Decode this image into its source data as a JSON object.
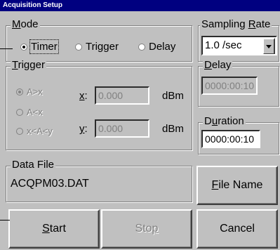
{
  "window": {
    "title": "Acquisition Setup"
  },
  "mode": {
    "label_pre": "",
    "label_acc": "M",
    "label_post": "ode",
    "options": [
      "Timer",
      "Trigger",
      "Delay"
    ],
    "selected": "Timer"
  },
  "sampling_rate": {
    "label_pre": "Sampling ",
    "label_acc": "R",
    "label_post": "ate",
    "value": "1.0 /sec"
  },
  "trigger": {
    "label_pre": "",
    "label_acc": "T",
    "label_post": "rigger",
    "options": [
      "A>x",
      "A<x",
      "x<A<y"
    ],
    "selected": "A>x",
    "x_acc": "x",
    "x_post": ":",
    "x_value": "0.000",
    "y_acc": "y",
    "y_post": ":",
    "y_value": "0.000",
    "unit": "dBm"
  },
  "delay": {
    "label_pre": "",
    "label_acc": "D",
    "label_post": "elay",
    "value": "0000:00:10"
  },
  "duration": {
    "label_pre": "D",
    "label_acc": "u",
    "label_post": "ration",
    "value": "0000:00:10"
  },
  "data_file": {
    "label": "Data File",
    "value": "ACQPM03.DAT"
  },
  "buttons": {
    "file_name_acc": "F",
    "file_name_post": "ile Name",
    "start_acc": "S",
    "start_post": "tart",
    "stop_pre": "Sto",
    "stop_acc": "p",
    "cancel": "Cancel"
  }
}
